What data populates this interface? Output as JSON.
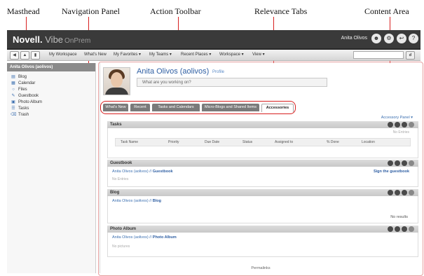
{
  "callouts": {
    "masthead": "Masthead",
    "navigation_panel": "Navigation Panel",
    "action_toolbar": "Action Toolbar",
    "relevance_tabs": "Relevance Tabs",
    "content_area": "Content Area"
  },
  "masthead": {
    "brand_main": "Novell.",
    "brand_product": "Vibe",
    "brand_edition": "OnPrem",
    "user_name": "Anita Olivos",
    "icons": [
      "person-icon",
      "settings-icon",
      "logout-icon",
      "help-icon"
    ]
  },
  "toolbar": {
    "items": [
      {
        "label": "My Workspace"
      },
      {
        "label": "What's New"
      },
      {
        "label": "My Favorites ▾"
      },
      {
        "label": "My Teams ▾"
      },
      {
        "label": "Recent Places ▾"
      },
      {
        "label": "Workspace ▾"
      },
      {
        "label": "View ▾"
      }
    ]
  },
  "navigation": {
    "header": "Anita Olivos (aolivos)",
    "items": [
      {
        "label": "Blog",
        "icon": "blog-icon"
      },
      {
        "label": "Calendar",
        "icon": "calendar-icon"
      },
      {
        "label": "Files",
        "icon": "files-icon"
      },
      {
        "label": "Guestbook",
        "icon": "guestbook-icon"
      },
      {
        "label": "Photo Album",
        "icon": "photo-album-icon"
      },
      {
        "label": "Tasks",
        "icon": "tasks-icon"
      },
      {
        "label": "Trash",
        "icon": "trash-icon"
      }
    ]
  },
  "profile": {
    "name": "Anita Olivos (aolivos)",
    "profile_link": "Profile",
    "status_placeholder": "What are you working on?"
  },
  "tabs": [
    {
      "label": "What's New",
      "active": false
    },
    {
      "label": "Recent",
      "active": false
    },
    {
      "label": "Tasks and Calendars",
      "active": false
    },
    {
      "label": "Micro-Blogs and Shared Items",
      "active": false
    },
    {
      "label": "Accessories",
      "active": true
    }
  ],
  "accessory_panel": "Accessory Panel ▾",
  "sections": {
    "tasks": {
      "title": "Tasks",
      "empty_text": "No Entries",
      "columns": [
        "Task Name",
        "Priority",
        "Due Date",
        "Status",
        "Assigned to",
        "% Done",
        "Location"
      ]
    },
    "guestbook": {
      "title": "Guestbook",
      "link_prefix": "Anita Olivos (aolivos) //",
      "link_target": "Guestbook",
      "action": "Sign the guestbook",
      "empty_text": "No Entries"
    },
    "blog": {
      "title": "Blog",
      "link_prefix": "Anita Olivos (aolivos) //",
      "link_target": "Blog",
      "results": "No results"
    },
    "photo_album": {
      "title": "Photo Album",
      "link_prefix": "Anita Olivos (aolivos) //",
      "link_target": "Photo Album",
      "empty_text": "No pictures"
    }
  },
  "permalink": "Permalinks",
  "colors": {
    "masthead_bg": "#3a3a3a",
    "callout_red": "#d72020",
    "link_blue": "#2f5fa3"
  }
}
